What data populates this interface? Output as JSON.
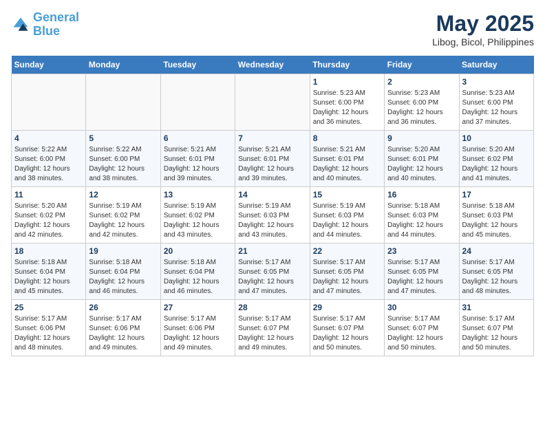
{
  "header": {
    "logo_line1": "General",
    "logo_line2": "Blue",
    "title": "May 2025",
    "subtitle": "Libog, Bicol, Philippines"
  },
  "calendar": {
    "weekdays": [
      "Sunday",
      "Monday",
      "Tuesday",
      "Wednesday",
      "Thursday",
      "Friday",
      "Saturday"
    ],
    "weeks": [
      [
        {
          "day": "",
          "info": ""
        },
        {
          "day": "",
          "info": ""
        },
        {
          "day": "",
          "info": ""
        },
        {
          "day": "",
          "info": ""
        },
        {
          "day": "1",
          "info": "Sunrise: 5:23 AM\nSunset: 6:00 PM\nDaylight: 12 hours\nand 36 minutes."
        },
        {
          "day": "2",
          "info": "Sunrise: 5:23 AM\nSunset: 6:00 PM\nDaylight: 12 hours\nand 36 minutes."
        },
        {
          "day": "3",
          "info": "Sunrise: 5:23 AM\nSunset: 6:00 PM\nDaylight: 12 hours\nand 37 minutes."
        }
      ],
      [
        {
          "day": "4",
          "info": "Sunrise: 5:22 AM\nSunset: 6:00 PM\nDaylight: 12 hours\nand 38 minutes."
        },
        {
          "day": "5",
          "info": "Sunrise: 5:22 AM\nSunset: 6:00 PM\nDaylight: 12 hours\nand 38 minutes."
        },
        {
          "day": "6",
          "info": "Sunrise: 5:21 AM\nSunset: 6:01 PM\nDaylight: 12 hours\nand 39 minutes."
        },
        {
          "day": "7",
          "info": "Sunrise: 5:21 AM\nSunset: 6:01 PM\nDaylight: 12 hours\nand 39 minutes."
        },
        {
          "day": "8",
          "info": "Sunrise: 5:21 AM\nSunset: 6:01 PM\nDaylight: 12 hours\nand 40 minutes."
        },
        {
          "day": "9",
          "info": "Sunrise: 5:20 AM\nSunset: 6:01 PM\nDaylight: 12 hours\nand 40 minutes."
        },
        {
          "day": "10",
          "info": "Sunrise: 5:20 AM\nSunset: 6:02 PM\nDaylight: 12 hours\nand 41 minutes."
        }
      ],
      [
        {
          "day": "11",
          "info": "Sunrise: 5:20 AM\nSunset: 6:02 PM\nDaylight: 12 hours\nand 42 minutes."
        },
        {
          "day": "12",
          "info": "Sunrise: 5:19 AM\nSunset: 6:02 PM\nDaylight: 12 hours\nand 42 minutes."
        },
        {
          "day": "13",
          "info": "Sunrise: 5:19 AM\nSunset: 6:02 PM\nDaylight: 12 hours\nand 43 minutes."
        },
        {
          "day": "14",
          "info": "Sunrise: 5:19 AM\nSunset: 6:03 PM\nDaylight: 12 hours\nand 43 minutes."
        },
        {
          "day": "15",
          "info": "Sunrise: 5:19 AM\nSunset: 6:03 PM\nDaylight: 12 hours\nand 44 minutes."
        },
        {
          "day": "16",
          "info": "Sunrise: 5:18 AM\nSunset: 6:03 PM\nDaylight: 12 hours\nand 44 minutes."
        },
        {
          "day": "17",
          "info": "Sunrise: 5:18 AM\nSunset: 6:03 PM\nDaylight: 12 hours\nand 45 minutes."
        }
      ],
      [
        {
          "day": "18",
          "info": "Sunrise: 5:18 AM\nSunset: 6:04 PM\nDaylight: 12 hours\nand 45 minutes."
        },
        {
          "day": "19",
          "info": "Sunrise: 5:18 AM\nSunset: 6:04 PM\nDaylight: 12 hours\nand 46 minutes."
        },
        {
          "day": "20",
          "info": "Sunrise: 5:18 AM\nSunset: 6:04 PM\nDaylight: 12 hours\nand 46 minutes."
        },
        {
          "day": "21",
          "info": "Sunrise: 5:17 AM\nSunset: 6:05 PM\nDaylight: 12 hours\nand 47 minutes."
        },
        {
          "day": "22",
          "info": "Sunrise: 5:17 AM\nSunset: 6:05 PM\nDaylight: 12 hours\nand 47 minutes."
        },
        {
          "day": "23",
          "info": "Sunrise: 5:17 AM\nSunset: 6:05 PM\nDaylight: 12 hours\nand 47 minutes."
        },
        {
          "day": "24",
          "info": "Sunrise: 5:17 AM\nSunset: 6:05 PM\nDaylight: 12 hours\nand 48 minutes."
        }
      ],
      [
        {
          "day": "25",
          "info": "Sunrise: 5:17 AM\nSunset: 6:06 PM\nDaylight: 12 hours\nand 48 minutes."
        },
        {
          "day": "26",
          "info": "Sunrise: 5:17 AM\nSunset: 6:06 PM\nDaylight: 12 hours\nand 49 minutes."
        },
        {
          "day": "27",
          "info": "Sunrise: 5:17 AM\nSunset: 6:06 PM\nDaylight: 12 hours\nand 49 minutes."
        },
        {
          "day": "28",
          "info": "Sunrise: 5:17 AM\nSunset: 6:07 PM\nDaylight: 12 hours\nand 49 minutes."
        },
        {
          "day": "29",
          "info": "Sunrise: 5:17 AM\nSunset: 6:07 PM\nDaylight: 12 hours\nand 50 minutes."
        },
        {
          "day": "30",
          "info": "Sunrise: 5:17 AM\nSunset: 6:07 PM\nDaylight: 12 hours\nand 50 minutes."
        },
        {
          "day": "31",
          "info": "Sunrise: 5:17 AM\nSunset: 6:07 PM\nDaylight: 12 hours\nand 50 minutes."
        }
      ]
    ]
  }
}
